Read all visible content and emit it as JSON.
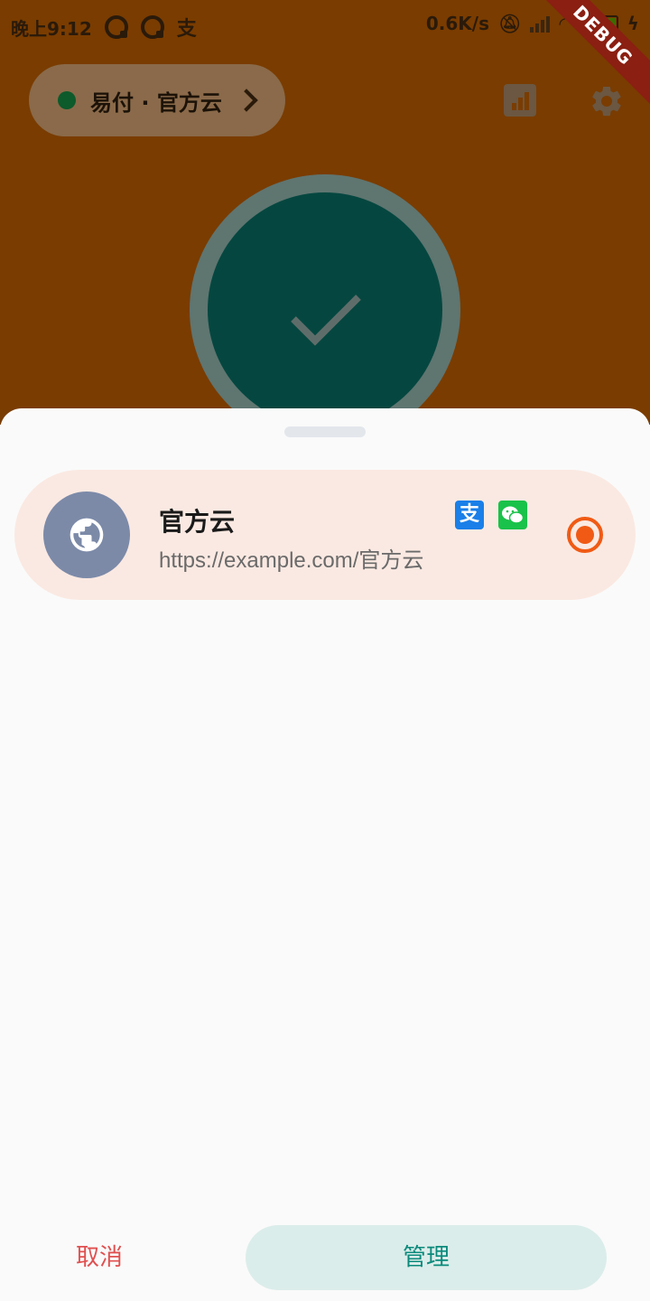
{
  "status_bar": {
    "time": "晚上9:12",
    "network_speed": "0.6K/s",
    "battery": "100",
    "notification_icons": [
      "app-circle-icon",
      "app-circle-icon",
      "alipay-icon"
    ]
  },
  "debug_banner": "DEBUG",
  "header": {
    "provider_label": "易付 · 官方云",
    "status_color": "#0d5a2b"
  },
  "connect_button": {
    "state": "connected",
    "icon": "check-icon"
  },
  "sheet": {
    "items": [
      {
        "name": "官方云",
        "url": "https://example.com/官方云",
        "icon": "globe-icon",
        "payments": [
          "alipay-icon",
          "wechat-pay-icon"
        ],
        "selected": true
      }
    ],
    "cancel_label": "取消",
    "manage_label": "管理"
  },
  "colors": {
    "accent": "#f05a14",
    "teal": "#0b8a7c",
    "danger": "#e05050",
    "card_bg": "#fae9e2"
  }
}
